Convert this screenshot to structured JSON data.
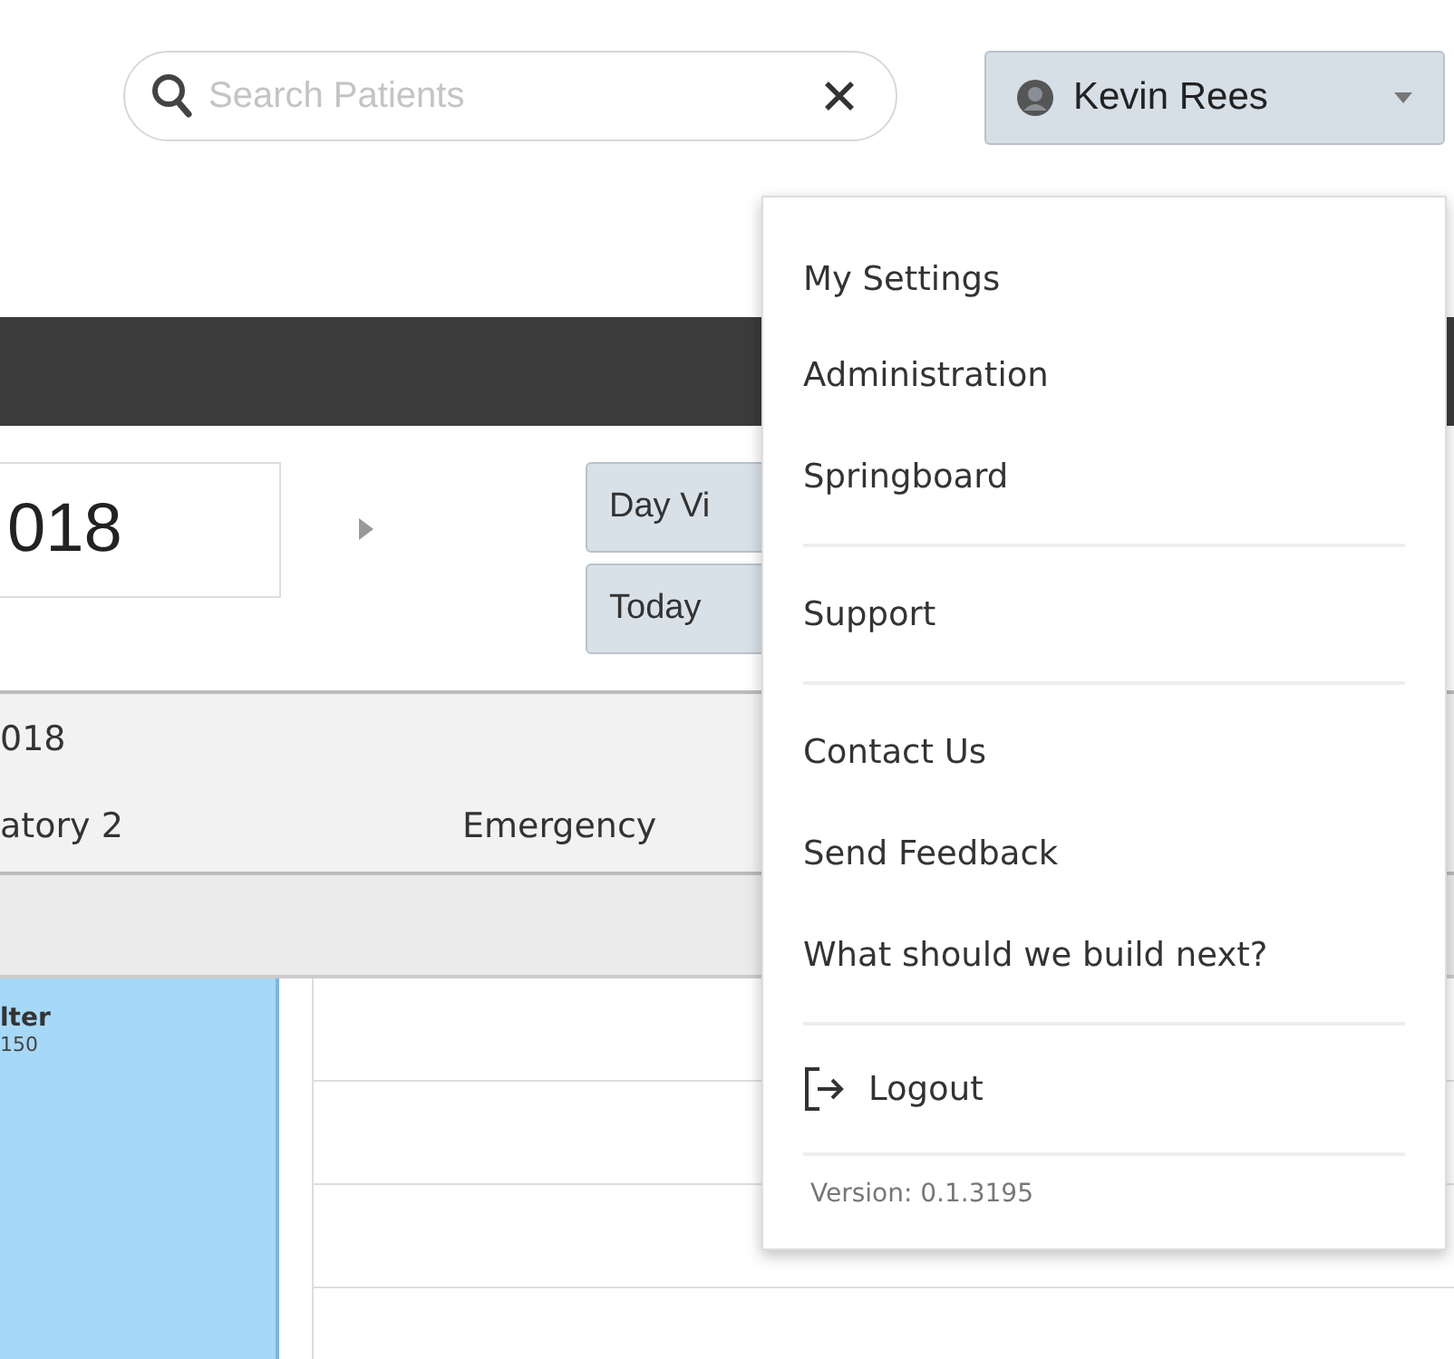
{
  "search": {
    "placeholder": "Search Patients"
  },
  "user": {
    "name": "Kevin Rees"
  },
  "date_field": {
    "value": "018"
  },
  "view_buttons": [
    "Day Vi",
    "Today"
  ],
  "schedule": {
    "date": "018",
    "columns": [
      "atory 2",
      "Emergency"
    ],
    "appointments": [
      {
        "title": "lter",
        "subtitle": "150"
      }
    ]
  },
  "menu": {
    "sections": [
      [
        {
          "kind": "link",
          "label": "My Settings"
        },
        {
          "kind": "link",
          "label": "Administration"
        },
        {
          "kind": "link",
          "label": "Springboard"
        }
      ],
      [
        {
          "kind": "link",
          "label": "Support"
        }
      ],
      [
        {
          "kind": "link",
          "label": "Contact Us"
        },
        {
          "kind": "link",
          "label": "Send Feedback"
        },
        {
          "kind": "link",
          "label": "What should we build next?"
        }
      ],
      [
        {
          "kind": "logout",
          "label": "Logout"
        }
      ]
    ],
    "version": "Version: 0.1.3195"
  }
}
